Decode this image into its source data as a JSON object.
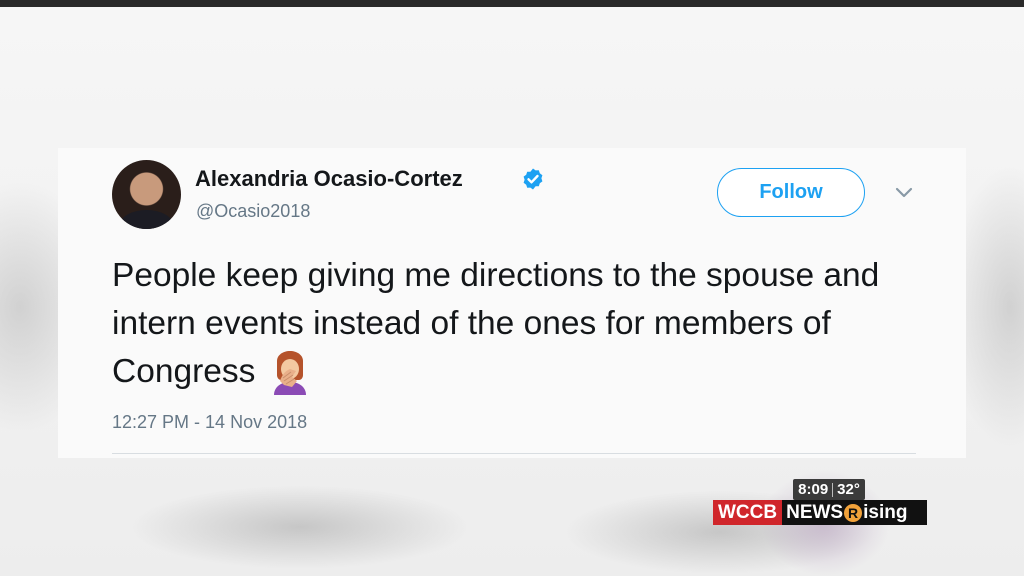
{
  "tweet": {
    "display_name": "Alexandria Ocasio-Cortez",
    "handle": "@Ocasio2018",
    "follow_label": "Follow",
    "text": "People keep giving me directions to the spouse and intern events instead of the ones for members of Congress",
    "timestamp": "12:27 PM - 14 Nov 2018",
    "emoji": "facepalm",
    "verified": true
  },
  "broadcast": {
    "time": "8:09",
    "temperature": "32°",
    "logo_station": "WCCB",
    "logo_news": "NEWS",
    "logo_r": "R",
    "logo_rising_rest": "ising"
  },
  "icons": {
    "verified": "verified-badge-icon",
    "menu": "chevron-down-icon"
  },
  "colors": {
    "accent": "#1da1f2",
    "station_red": "#d0262b",
    "text_primary": "#14171a",
    "text_secondary": "#657786"
  }
}
